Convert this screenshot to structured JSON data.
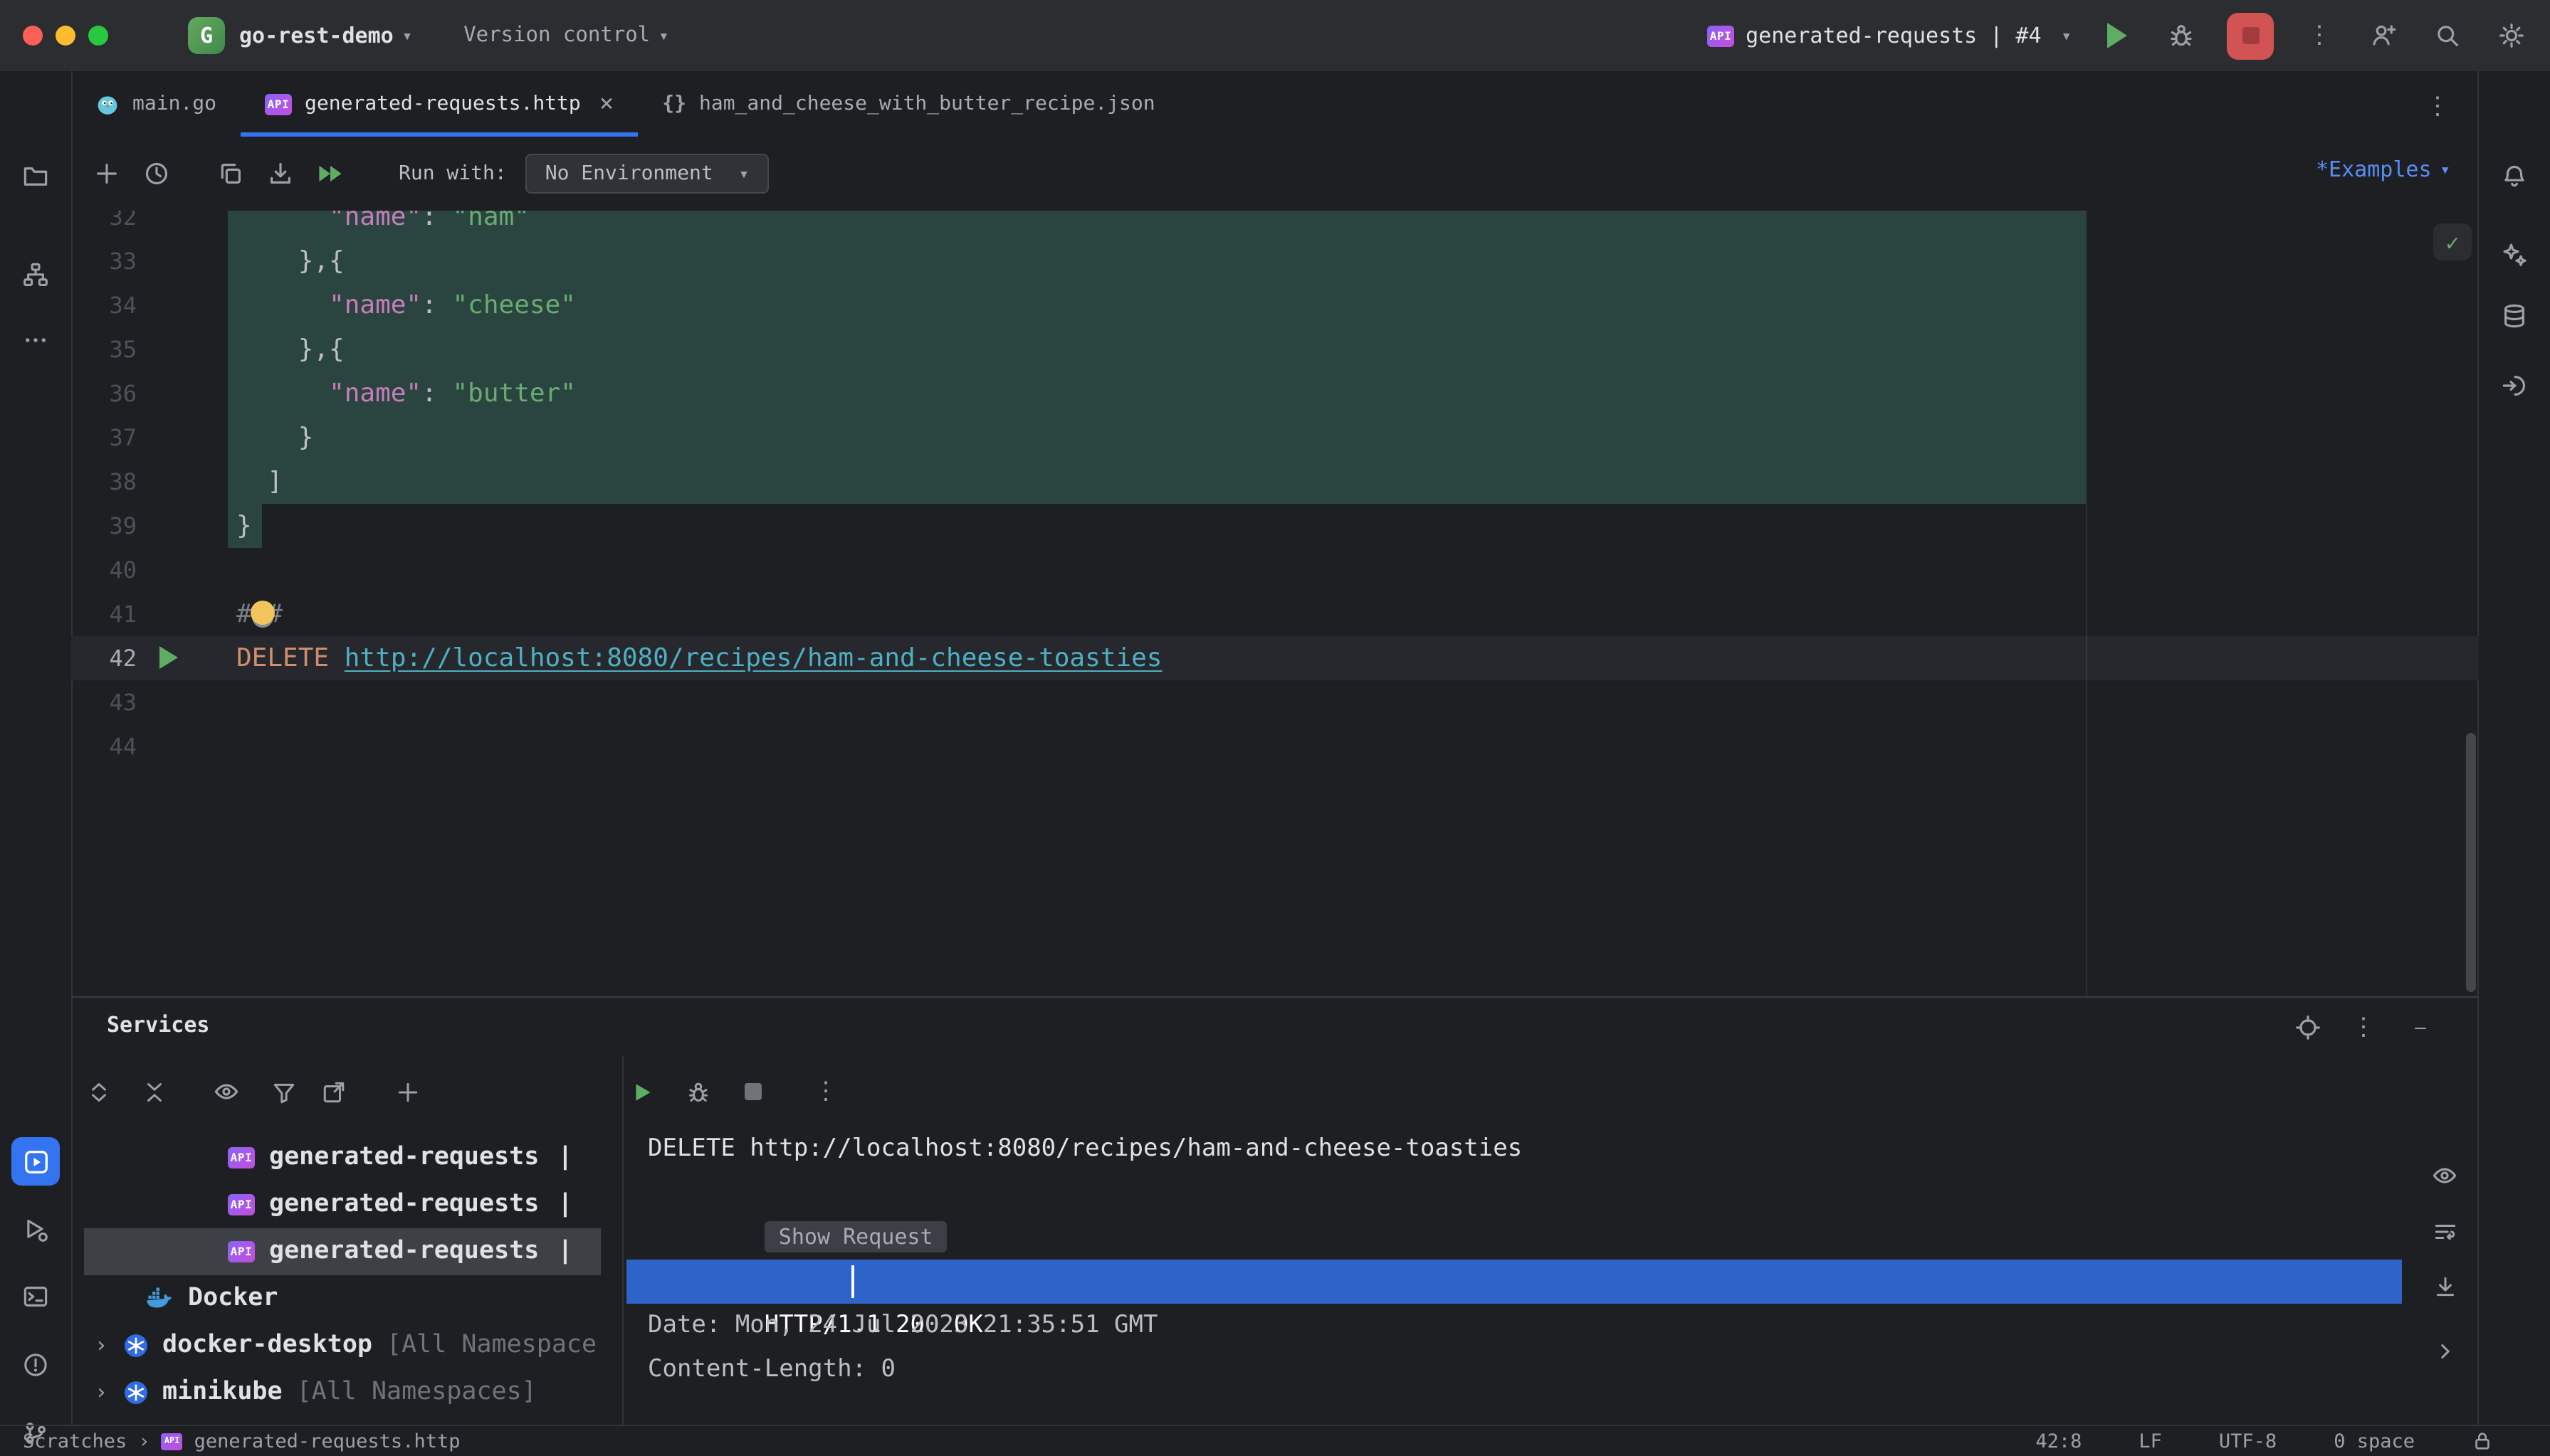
{
  "titlebar": {
    "project_badge_letter": "G",
    "project_name": "go-rest-demo",
    "vcs_label": "Version control",
    "run_config_label": "generated-requests | #4"
  },
  "tabbar": {
    "tabs": [
      {
        "label": "main.go"
      },
      {
        "label": "generated-requests.http"
      },
      {
        "label": "ham_and_cheese_with_butter_recipe.json"
      }
    ]
  },
  "http_toolbar": {
    "run_with_label": "Run with:",
    "environment_value": "No Environment",
    "examples_label": "*Examples"
  },
  "editor": {
    "current_line_number": 42,
    "lines": [
      {
        "no": 32,
        "segments": [
          {
            "t": "      ",
            "c": "punct"
          },
          {
            "t": "\"name\"",
            "c": "key"
          },
          {
            "t": ": ",
            "c": "punct"
          },
          {
            "t": "\"ham\"",
            "c": "str"
          }
        ]
      },
      {
        "no": 33,
        "segments": [
          {
            "t": "    },{",
            "c": "punct"
          }
        ]
      },
      {
        "no": 34,
        "segments": [
          {
            "t": "      ",
            "c": "punct"
          },
          {
            "t": "\"name\"",
            "c": "key"
          },
          {
            "t": ": ",
            "c": "punct"
          },
          {
            "t": "\"cheese\"",
            "c": "str"
          }
        ]
      },
      {
        "no": 35,
        "segments": [
          {
            "t": "    },{",
            "c": "punct"
          }
        ]
      },
      {
        "no": 36,
        "segments": [
          {
            "t": "      ",
            "c": "punct"
          },
          {
            "t": "\"name\"",
            "c": "key"
          },
          {
            "t": ": ",
            "c": "punct"
          },
          {
            "t": "\"butter\"",
            "c": "str"
          }
        ]
      },
      {
        "no": 37,
        "segments": [
          {
            "t": "    }",
            "c": "punct"
          }
        ]
      },
      {
        "no": 38,
        "segments": [
          {
            "t": "  ]",
            "c": "punct"
          }
        ]
      },
      {
        "no": 39,
        "segments": [
          {
            "t": "}",
            "c": "punct"
          }
        ]
      },
      {
        "no": 40,
        "segments": []
      },
      {
        "no": 41,
        "segments": [
          {
            "t": "###",
            "c": "comment"
          }
        ]
      },
      {
        "no": 42,
        "current": true,
        "segments": [
          {
            "t": "DELETE",
            "c": "method"
          },
          {
            "t": " ",
            "c": "punct"
          },
          {
            "t": "http://localhost:8080/recipes/ham-and-cheese-toasties",
            "c": "url"
          }
        ]
      },
      {
        "no": 43,
        "segments": []
      },
      {
        "no": 44,
        "segments": []
      }
    ]
  },
  "services": {
    "panel_title": "Services",
    "tree": [
      {
        "label": "generated-requests",
        "suffix": "|"
      },
      {
        "label": "generated-requests",
        "suffix": "|"
      },
      {
        "label": "generated-requests",
        "suffix": "|"
      },
      {
        "label": "Docker",
        "suffix": ""
      },
      {
        "label": "docker-desktop",
        "suffix": "[All Namespace"
      },
      {
        "label": "minikube",
        "suffix": "[All Namespaces]"
      }
    ],
    "console": {
      "request_line": "DELETE http://localhost:8080/recipes/ham-and-cheese-toasties",
      "show_request_label": "Show Request",
      "response_status": "HTTP/1.1 200 OK",
      "response_headers": [
        "Date: Mon, 24 Jul 2023 21:35:51 GMT",
        "Content-Length: 0"
      ]
    }
  },
  "statusbar": {
    "breadcrumb_root": "Scratches",
    "breadcrumb_file": "generated-requests.http",
    "caret_position": "42:8",
    "line_separator": "LF",
    "encoding": "UTF-8",
    "indent_info": "0 space"
  },
  "icons": {
    "chevron_down": "▾",
    "chevron_right": "›",
    "close": "×",
    "kebab": "⋮",
    "plus": "+",
    "minus": "—",
    "braces": "{}",
    "check": "✓"
  },
  "colors": {
    "accent_blue": "#3574f0",
    "selection_blue": "#2e63c9",
    "run_green": "#5fad65",
    "stop_red": "#d25353",
    "injected_fragment_teal": "#2a453f"
  }
}
